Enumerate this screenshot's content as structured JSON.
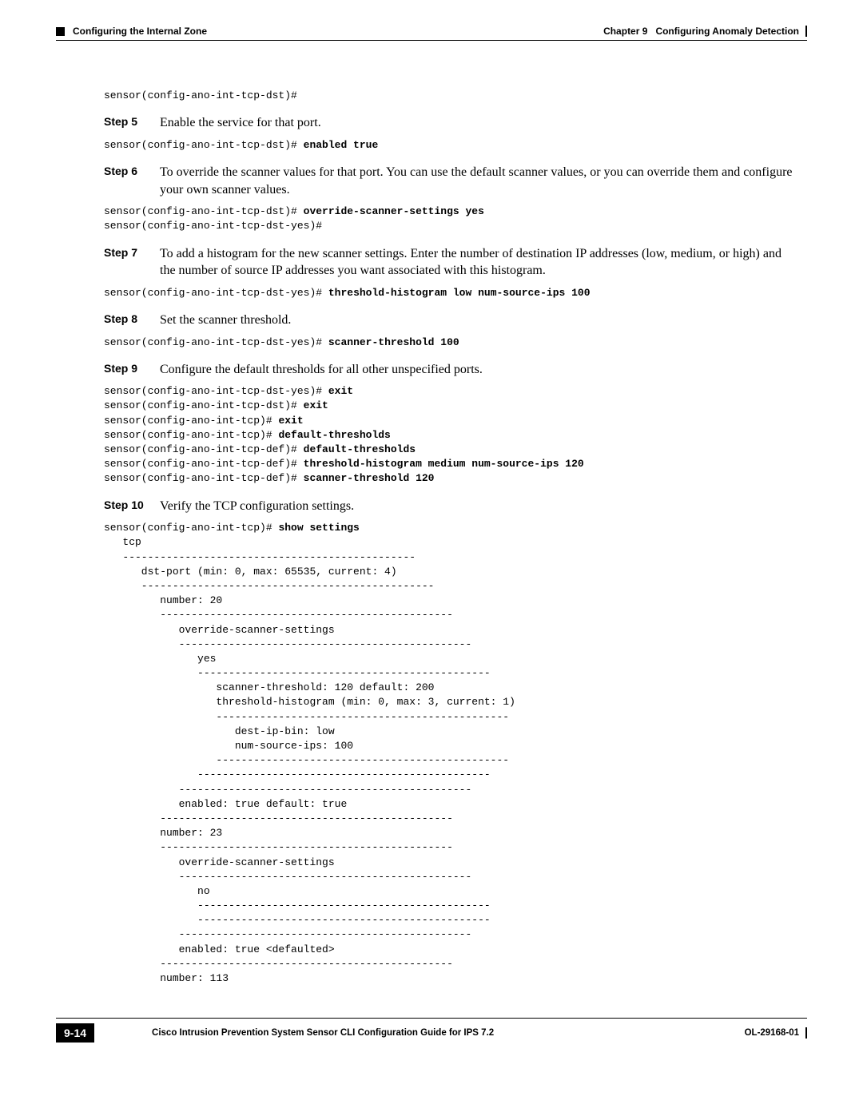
{
  "header": {
    "chapter": "Chapter 9",
    "chapter_title": "Configuring Anomaly Detection",
    "section": "Configuring the Internal Zone"
  },
  "pre_code": "sensor(config-ano-int-tcp-dst)#",
  "steps": {
    "s5": {
      "label": "Step 5",
      "text": "Enable the service for that port.",
      "code_prefix": "sensor(config-ano-int-tcp-dst)# ",
      "code_bold": "enabled true"
    },
    "s6": {
      "label": "Step 6",
      "text": "To override the scanner values for that port. You can use the default scanner values, or you can override them and configure your own scanner values.",
      "code_line1_prefix": "sensor(config-ano-int-tcp-dst)# ",
      "code_line1_bold": "override-scanner-settings yes",
      "code_line2": "sensor(config-ano-int-tcp-dst-yes)#"
    },
    "s7": {
      "label": "Step 7",
      "text": "To add a histogram for the new scanner settings. Enter the number of destination IP addresses (low, medium, or high) and the number of source IP addresses you want associated with this histogram.",
      "code_prefix": "sensor(config-ano-int-tcp-dst-yes)# ",
      "code_bold": "threshold-histogram low num-source-ips 100"
    },
    "s8": {
      "label": "Step 8",
      "text": "Set the scanner threshold.",
      "code_prefix": "sensor(config-ano-int-tcp-dst-yes)# ",
      "code_bold": "scanner-threshold 100"
    },
    "s9": {
      "label": "Step 9",
      "text": "Configure the default thresholds for all other unspecified ports.",
      "l1p": "sensor(config-ano-int-tcp-dst-yes)# ",
      "l1b": "exit",
      "l2p": "sensor(config-ano-int-tcp-dst)# ",
      "l2b": "exit",
      "l3p": "sensor(config-ano-int-tcp)# ",
      "l3b": "exit",
      "l4p": "sensor(config-ano-int-tcp)# ",
      "l4b": "default-thresholds",
      "l5p": "sensor(config-ano-int-tcp-def)# ",
      "l5b": "default-thresholds",
      "l6p": "sensor(config-ano-int-tcp-def)# ",
      "l6b": "threshold-histogram medium num-source-ips 120",
      "l7p": "sensor(config-ano-int-tcp-def)# ",
      "l7b": "scanner-threshold 120"
    },
    "s10": {
      "label": "Step 10",
      "text": "Verify the TCP configuration settings.",
      "code_prefix": "sensor(config-ano-int-tcp)# ",
      "code_bold": "show settings",
      "output": "   tcp\n   -----------------------------------------------\n      dst-port (min: 0, max: 65535, current: 4)\n      -----------------------------------------------\n         number: 20\n         -----------------------------------------------\n            override-scanner-settings\n            -----------------------------------------------\n               yes\n               -----------------------------------------------\n                  scanner-threshold: 120 default: 200\n                  threshold-histogram (min: 0, max: 3, current: 1)\n                  -----------------------------------------------\n                     dest-ip-bin: low\n                     num-source-ips: 100\n                  -----------------------------------------------\n               -----------------------------------------------\n            -----------------------------------------------\n            enabled: true default: true\n         -----------------------------------------------\n         number: 23\n         -----------------------------------------------\n            override-scanner-settings\n            -----------------------------------------------\n               no\n               -----------------------------------------------\n               -----------------------------------------------\n            -----------------------------------------------\n            enabled: true <defaulted>\n         -----------------------------------------------\n         number: 113"
    }
  },
  "footer": {
    "book_title": "Cisco Intrusion Prevention System Sensor CLI Configuration Guide for IPS 7.2",
    "page_number": "9-14",
    "doc_id": "OL-29168-01"
  }
}
